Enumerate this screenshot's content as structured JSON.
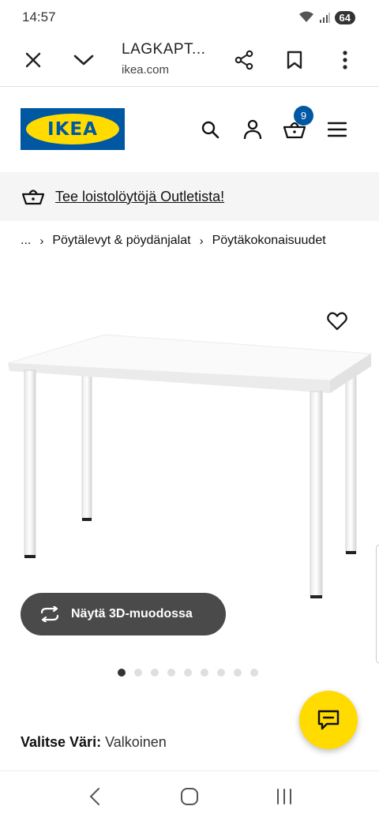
{
  "status": {
    "time": "14:57",
    "battery": "64"
  },
  "browser": {
    "title": "LAGKAPT...",
    "domain": "ikea.com"
  },
  "header": {
    "logo_text": "IKEA",
    "cart_count": "9"
  },
  "promo": {
    "text": "Tee loistolöytöjä Outletista!"
  },
  "breadcrumb": [
    "...",
    "Pöytälevyt & pöydänjalat",
    "Pöytäkokonaisuudet"
  ],
  "product": {
    "view_3d_label": "Näytä 3D-muodossa",
    "image_count": 9,
    "active_image": 0
  },
  "color": {
    "label": "Valitse Väri:",
    "value": "Valkoinen"
  },
  "colors": {
    "ikea_blue": "#0058a3",
    "ikea_yellow": "#ffdb00",
    "button_dark": "#4a4a4a"
  }
}
